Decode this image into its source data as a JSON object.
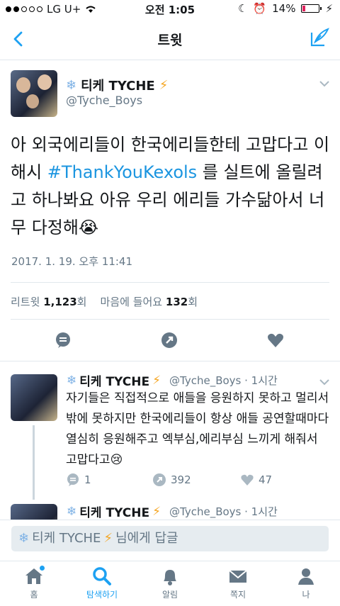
{
  "status": {
    "carrier": "LG U+",
    "time": "오전 1:05",
    "battery": "14%"
  },
  "nav": {
    "title": "트윗"
  },
  "tweet": {
    "name": "티케 TYCHE",
    "handle": "@Tyche_Boys",
    "text_before": "아 외국에리들이 한국에리들한테 고맙다고 이 해시 ",
    "hashtag": "#ThankYouKexols",
    "text_after": " 를 실트에 올릴려고 하나봐요 아유 우리 에리들 가수닮아서 너무 다정해",
    "timestamp": "2017. 1. 19. 오후 11:41",
    "retweets_label": "리트윗",
    "retweets_count": "1,123",
    "retweets_unit": "회",
    "likes_label": "마음에 들어요",
    "likes_count": "132",
    "likes_unit": "회"
  },
  "reply": {
    "name": "티케 TYCHE",
    "handle_meta": "@Tyche_Boys · 1시간",
    "text": "자기들은 직접적으로 애들을 응원하지 못하고 멀리서밖에 못하지만 한국에리들이 항상 애들 공연할때마다 열심히 응원해주고 엑부심,에리부심 느끼게 해줘서 고맙다고",
    "reply_count": "1",
    "retweet_count": "392",
    "like_count": "47"
  },
  "next_reply": {
    "name": "티케 TYCHE",
    "handle_meta": "@Tyche_Boys · 1시간"
  },
  "reply_bar": {
    "name": "티케 TYCHE",
    "suffix": "님에게 답글"
  },
  "tabs": [
    {
      "label": "홈",
      "icon": "home-icon"
    },
    {
      "label": "탐색하기",
      "icon": "search-icon"
    },
    {
      "label": "알림",
      "icon": "bell-icon"
    },
    {
      "label": "쪽지",
      "icon": "mail-icon"
    },
    {
      "label": "나",
      "icon": "person-icon"
    }
  ],
  "colors": {
    "accent": "#1da1f2",
    "hashtag": "#1b95e0",
    "muted": "#657786",
    "lightning": "#f5a623"
  }
}
